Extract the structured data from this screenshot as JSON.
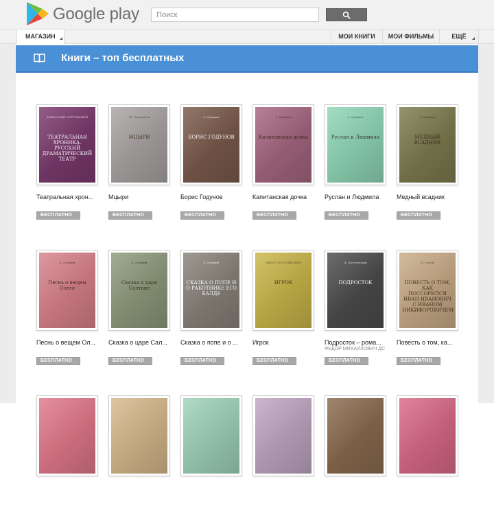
{
  "header": {
    "logo_text": "Google play",
    "search_placeholder": "Поиск",
    "search_value": ""
  },
  "nav": {
    "store_label": "МАГАЗИН",
    "my_books_label": "МОИ КНИГИ",
    "my_movies_label": "МОИ ФИЛЬМЫ",
    "more_label": "ЕЩЁ"
  },
  "section": {
    "title": "Книги – топ бесплатных",
    "accent_color": "#4a90d6"
  },
  "free_label": "БЕСПЛАТНО",
  "books": [
    {
      "title": "Театральная хрон...",
      "author": "",
      "cover_author": "АЛЕКСАНДР ОСТРОВСКИЙ",
      "cover_title": "ТЕАТРАЛЬНАЯ ХРОНИКА. РУССКИЙ ДРАМАТИЧЕСКИЙ ТЕАТР",
      "cover_color": "#7b3a6e"
    },
    {
      "title": "Мцыри",
      "author": "",
      "cover_author": "М. Лермонтов",
      "cover_title": "МЦЫРИ",
      "cover_color": "#a9a4a3"
    },
    {
      "title": "Борис Годунов",
      "author": "",
      "cover_author": "А. Пушкин",
      "cover_title": "БОРИС ГОДУНОВ",
      "cover_color": "#7a5a4c"
    },
    {
      "title": "Капитанская дочка",
      "author": "",
      "cover_author": "А. Пушкин",
      "cover_title": "Капитанская дочка",
      "cover_color": "#a4667f"
    },
    {
      "title": "Руслан и Людмила",
      "author": "",
      "cover_author": "А. Пушкин",
      "cover_title": "Руслан и Людмила",
      "cover_color": "#8fd6b6"
    },
    {
      "title": "Медный всадник",
      "author": "",
      "cover_author": "А. Пушкин",
      "cover_title": "МЕДНЫЙ ВСАДНИК",
      "cover_color": "#7d7b4f"
    },
    {
      "title": "Песнь о вещем Ол...",
      "author": "",
      "cover_author": "А. Пушкин",
      "cover_title": "Песнь о вещем Олеге",
      "cover_color": "#d8818a"
    },
    {
      "title": "Сказка о царе Сал...",
      "author": "",
      "cover_author": "А. Пушкин",
      "cover_title": "Сказка о царе Салтане",
      "cover_color": "#8e9a7c"
    },
    {
      "title": "Сказка о попе и о ...",
      "author": "",
      "cover_author": "А. Пушкин",
      "cover_title": "СКАЗКА О ПОПЕ И О РАБОТНИКЕ ЕГО БАЛДЕ",
      "cover_color": "#88837a"
    },
    {
      "title": "Игрок",
      "author": "",
      "cover_author": "ФЁДОР ДОСТОЕВСКИЙ",
      "cover_title": "ИГРОК",
      "cover_color": "#c9b64a"
    },
    {
      "title": "Подросток – рома...",
      "author": "ФЁДОР МИХАЙЛОВИЧ ДС",
      "cover_author": "Ф. Достоевский",
      "cover_title": "ПОДРОСТОК",
      "cover_color": "#4c4c4c"
    },
    {
      "title": "Повесть о том, ка...",
      "author": "",
      "cover_author": "Н. Гоголь",
      "cover_title": "ПОВЕСТЬ О ТОМ, КАК ПОССОРИЛСЯ ИВАН ИВАНОВИЧ С ИВАНОМ НИКИФОРОВИЧЕМ",
      "cover_color": "#c8ab87"
    },
    {
      "title": "",
      "author": "",
      "cover_author": "",
      "cover_title": "",
      "cover_color": "#e0788a"
    },
    {
      "title": "",
      "author": "",
      "cover_author": "",
      "cover_title": "",
      "cover_color": "#d6b98c"
    },
    {
      "title": "",
      "author": "",
      "cover_author": "",
      "cover_title": "",
      "cover_color": "#9fd3b8"
    },
    {
      "title": "",
      "author": "",
      "cover_author": "",
      "cover_title": "",
      "cover_color": "#bfa6c2"
    },
    {
      "title": "",
      "author": "",
      "cover_author": "",
      "cover_title": "",
      "cover_color": "#8a6b4e"
    },
    {
      "title": "",
      "author": "",
      "cover_author": "",
      "cover_title": "",
      "cover_color": "#d96a86"
    }
  ]
}
